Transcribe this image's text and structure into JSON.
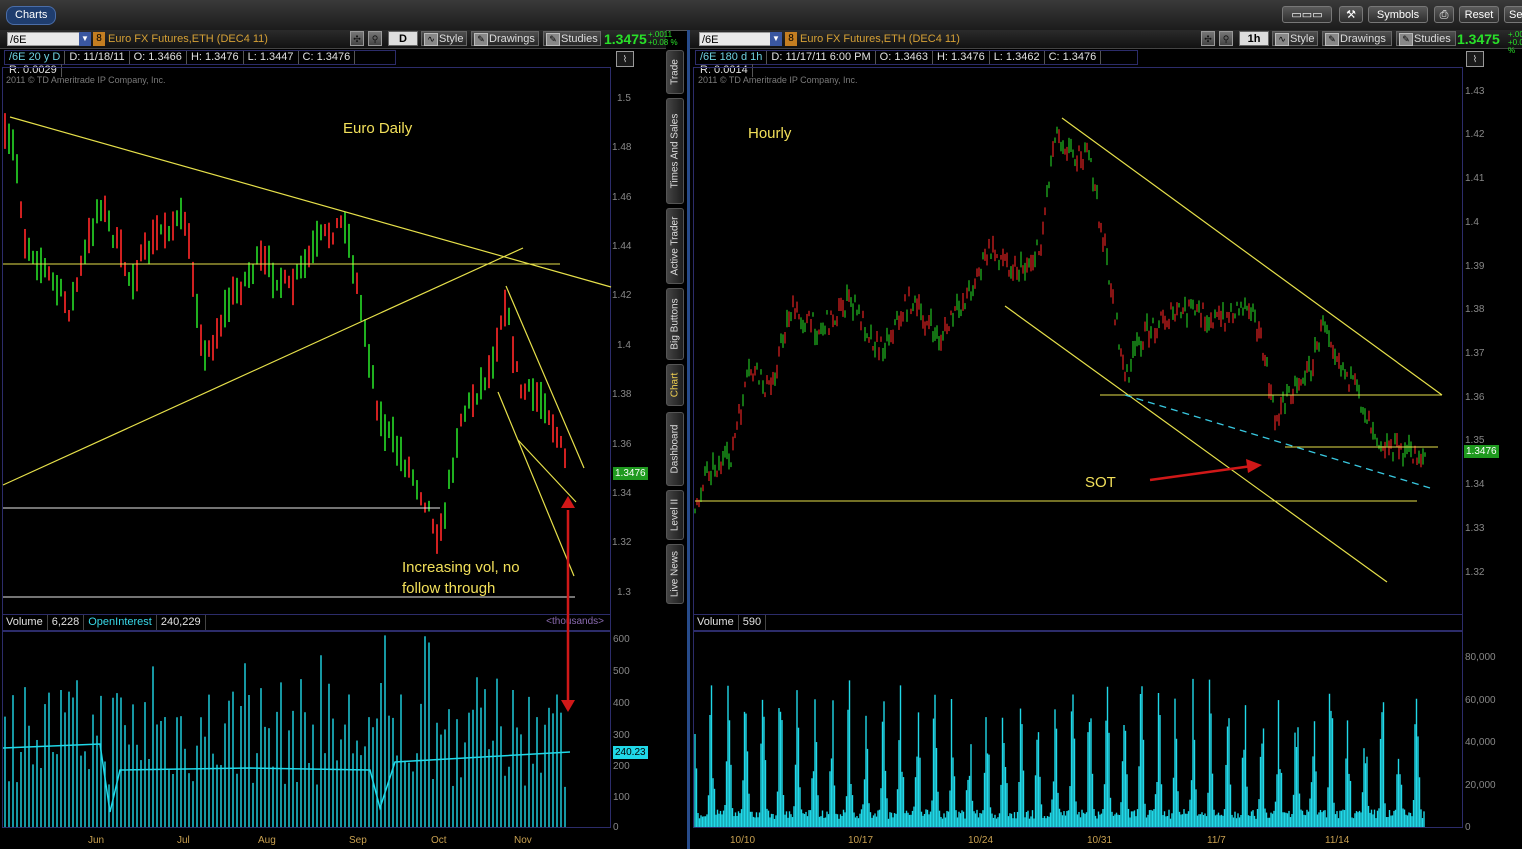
{
  "top_bar": {
    "tab_label": "Charts",
    "buttons": [
      "Symbols",
      "Reset",
      "Se"
    ]
  },
  "left_panel": {
    "symbol": "/6E",
    "link_number": "8",
    "product": "Euro FX Futures,ETH (DEC4 11)",
    "aggregation_label": "D",
    "style_label": "Style",
    "drawings_label": "Drawings",
    "studies_label": "Studies",
    "last_price": "1.3475",
    "change_abs": "+.0011",
    "change_pct": "+0.08 %",
    "ohlc": [
      "/6E 20 y D",
      "D: 11/18/11",
      "O: 1.3466",
      "H: 1.3476",
      "L: 1.3447",
      "C: 1.3476",
      "R: 0.0029"
    ],
    "copyright": "2011 © TD Ameritrade IP Company, Inc.",
    "y_ticks": [
      "1.5",
      "1.48",
      "1.46",
      "1.44",
      "1.42",
      "1.4",
      "1.38",
      "1.36",
      "1.34",
      "1.32",
      "1.3"
    ],
    "price_badge": "1.3476",
    "volume_header": [
      "Volume",
      "6,228",
      "OpenInterest",
      "240,229"
    ],
    "volume_units": "<thousands>",
    "volume_ticks": [
      "600",
      "500",
      "400",
      "300",
      "200",
      "100",
      "0"
    ],
    "oi_badge": "240.23",
    "x_ticks": [
      "Jun",
      "Jul",
      "Aug",
      "Sep",
      "Oct",
      "Nov"
    ],
    "annotation_title": "Euro Daily",
    "annotation_note_line1": "Increasing vol, no",
    "annotation_note_line2": "follow through"
  },
  "right_panel": {
    "symbol": "/6E",
    "link_number": "8",
    "product": "Euro FX Futures,ETH (DEC4 11)",
    "aggregation_label": "1h",
    "style_label": "Style",
    "drawings_label": "Drawings",
    "studies_label": "Studies",
    "last_price": "1.3475",
    "change_abs": "+.0011",
    "change_pct": "+0.08 %",
    "ohlc": [
      "/6E 180 d 1h",
      "D: 11/17/11 6:00 PM",
      "O: 1.3463",
      "H: 1.3476",
      "L: 1.3462",
      "C: 1.3476",
      "R: 0.0014"
    ],
    "copyright": "2011 © TD Ameritrade IP Company, Inc.",
    "y_ticks": [
      "1.43",
      "1.42",
      "1.41",
      "1.4",
      "1.39",
      "1.38",
      "1.37",
      "1.36",
      "1.35",
      "1.34",
      "1.33",
      "1.32"
    ],
    "price_badge": "1.3476",
    "volume_header": [
      "Volume",
      "590"
    ],
    "volume_ticks": [
      "80,000",
      "60,000",
      "40,000",
      "20,000",
      "0"
    ],
    "x_ticks": [
      "10/10",
      "10/17",
      "10/24",
      "10/31",
      "11/7",
      "11/14"
    ],
    "annotation_title": "Hourly",
    "annotation_sot": "SOT"
  },
  "side_tabs": [
    "Trade",
    "Times And Sales",
    "Active Trader",
    "Big Buttons",
    "Chart",
    "Dashboard",
    "Level II",
    "Live News"
  ],
  "colors": {
    "up_bar": "#1fb01f",
    "down_bar": "#d02020",
    "trendline": "#e6e04a",
    "volume": "#20d8e8",
    "annotation_arrow": "#d01818",
    "support_dashed": "#38c8e0",
    "price_badge": "#1f9a1f"
  }
}
